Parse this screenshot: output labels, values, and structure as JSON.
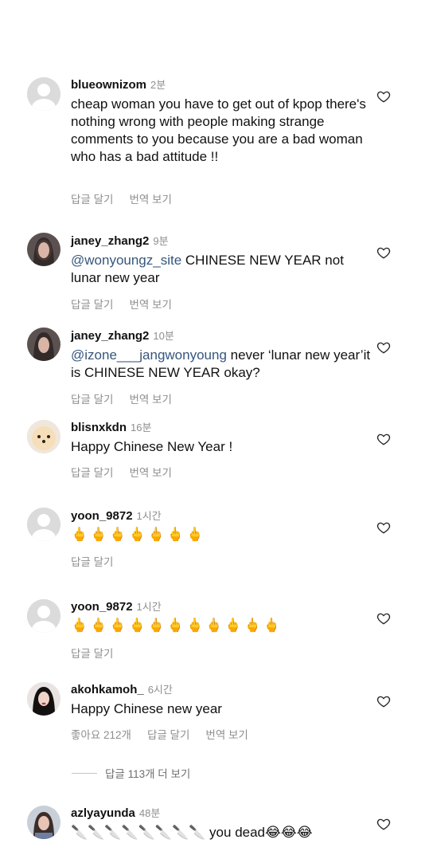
{
  "comments": [
    {
      "user": "blueownizom",
      "time": "2분",
      "text": "cheap woman you have to get out of kpop there's nothing wrong with people making strange comments to you because you are a bad woman who has a bad attitude !!",
      "reply": "답글 달기",
      "translate": "번역 보기"
    },
    {
      "user": "janey_zhang2",
      "time": "9분",
      "mention": "@wonyoungz_site",
      "text": " CHINESE NEW YEAR not lunar new year",
      "reply": "답글 달기",
      "translate": "번역 보기"
    },
    {
      "user": "janey_zhang2",
      "time": "10분",
      "mention": "@izone___jangwonyoung",
      "text": " never ‘lunar new year’it is CHINESE NEW YEAR okay?",
      "reply": "답글 달기",
      "translate": "번역 보기"
    },
    {
      "user": "blisnxkdn",
      "time": "16분",
      "text": "Happy Chinese New Year !",
      "reply": "답글 달기",
      "translate": "번역 보기"
    },
    {
      "user": "yoon_9872",
      "time": "1시간",
      "text": "🖕🖕🖕🖕🖕🖕🖕",
      "reply": "답글 달기"
    },
    {
      "user": "yoon_9872",
      "time": "1시간",
      "text": "🖕🖕🖕🖕🖕🖕🖕🖕🖕🖕🖕",
      "reply": "답글 달기"
    },
    {
      "user": "akohkamoh_",
      "time": "6시간",
      "text": "Happy Chinese new year",
      "likes": "좋아요 212개",
      "reply": "답글 달기",
      "translate": "번역 보기"
    },
    {
      "user": "azlyayunda",
      "time": "48분",
      "text": "🔪🔪🔪🔪🔪🔪🔪🔪 you dead😂😂😂"
    }
  ],
  "view_more_replies": "답글 113개 더 보기",
  "icons": {
    "like": "heart-outline-icon",
    "avatar_default": "default-avatar-icon"
  }
}
